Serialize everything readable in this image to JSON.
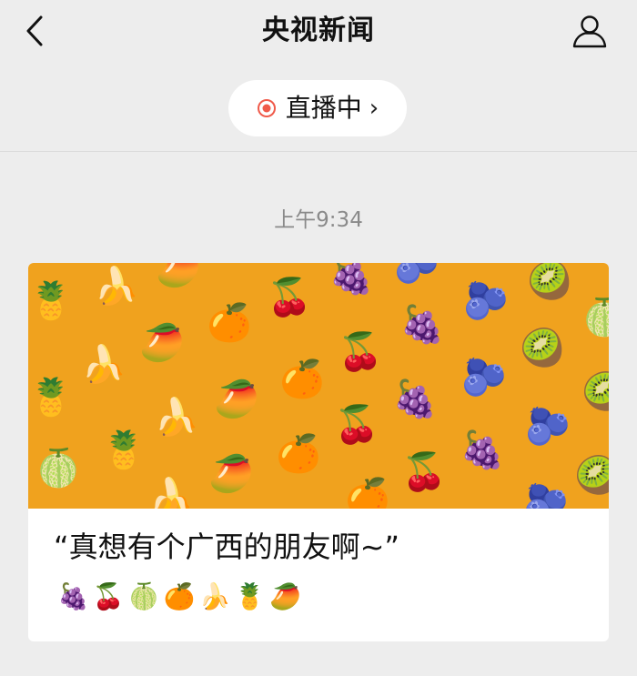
{
  "header": {
    "title": "央视新闻"
  },
  "live": {
    "label": "直播中",
    "chevron": "›",
    "accent": "#f05a4a"
  },
  "feed": {
    "timestamp": "上午9:34",
    "card": {
      "title": "“真想有个广西的朋友啊~”",
      "emojis": "🍇🍒🍈🍊🍌🍍🥭",
      "cover_background": "#f0a21e"
    }
  },
  "icons": {
    "back": "back-icon",
    "profile": "user-profile-icon",
    "live_dot": "live-record-dot-icon"
  }
}
